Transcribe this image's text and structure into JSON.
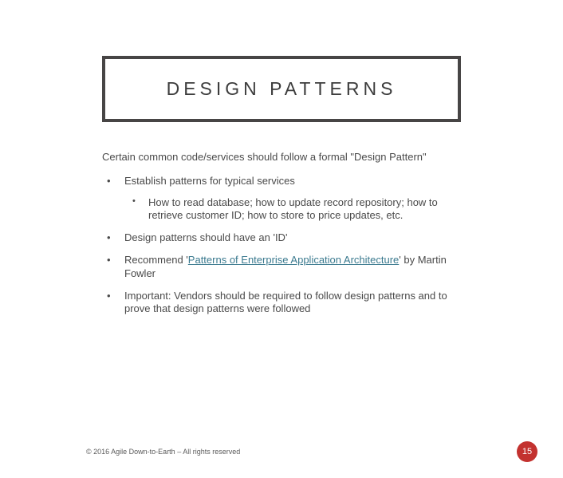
{
  "title": "DESIGN PATTERNS",
  "intro": "Certain common code/services should follow a formal \"Design Pattern\"",
  "bullets": {
    "b1": "Establish patterns for typical services",
    "b1_sub1": "How to read database; how to update record repository; how to retrieve customer ID; how to store to price updates, etc.",
    "b2": "Design patterns should have an 'ID'",
    "b3_pre": "Recommend '",
    "b3_link": "Patterns of Enterprise Application Architecture",
    "b3_post": "' by Martin Fowler",
    "b4": "Important:  Vendors should be required to follow design patterns and to prove that design patterns were followed"
  },
  "footer": "© 2016 Agile Down-to-Earth – All rights reserved",
  "page_number": "15"
}
